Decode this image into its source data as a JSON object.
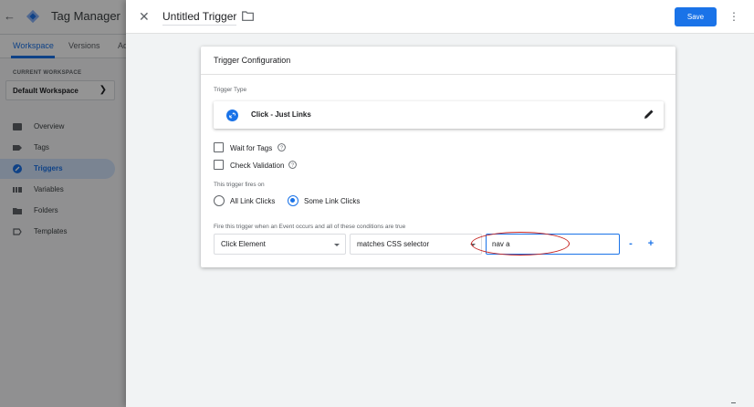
{
  "app": {
    "title": "Tag Manager",
    "tabs": [
      {
        "label": "Workspace",
        "active": true
      },
      {
        "label": "Versions",
        "active": false
      },
      {
        "label": "Ad",
        "active": false
      }
    ],
    "workspace_label": "CURRENT WORKSPACE",
    "workspace_name": "Default Workspace",
    "nav": [
      {
        "label": "Overview",
        "icon": "overview-icon",
        "active": false
      },
      {
        "label": "Tags",
        "icon": "tag-icon",
        "active": false
      },
      {
        "label": "Triggers",
        "icon": "trigger-icon",
        "active": true
      },
      {
        "label": "Variables",
        "icon": "variables-icon",
        "active": false
      },
      {
        "label": "Folders",
        "icon": "folder-icon",
        "active": false
      },
      {
        "label": "Templates",
        "icon": "templates-icon",
        "active": false
      }
    ]
  },
  "panel": {
    "trigger_name": "Untitled Trigger",
    "save_label": "Save",
    "card_title": "Trigger Configuration",
    "trigger_type_label": "Trigger Type",
    "trigger_type": "Click - Just Links",
    "wait_for_tags": "Wait for Tags",
    "check_validation": "Check Validation",
    "fires_on_label": "This trigger fires on",
    "fires_on_options": [
      "All Link Clicks",
      "Some Link Clicks"
    ],
    "fires_on_selected": "Some Link Clicks",
    "conditions_label": "Fire this trigger when an Event occurs and all of these conditions are true",
    "condition": {
      "variable": "Click Element",
      "operator": "matches CSS selector",
      "value": "nav a"
    },
    "minus_label": "-",
    "plus_label": "+"
  },
  "colors": {
    "accent": "#1a73e8",
    "highlight_ellipse": "#c5221f",
    "active_nav_bg": "#d2e3fc"
  }
}
